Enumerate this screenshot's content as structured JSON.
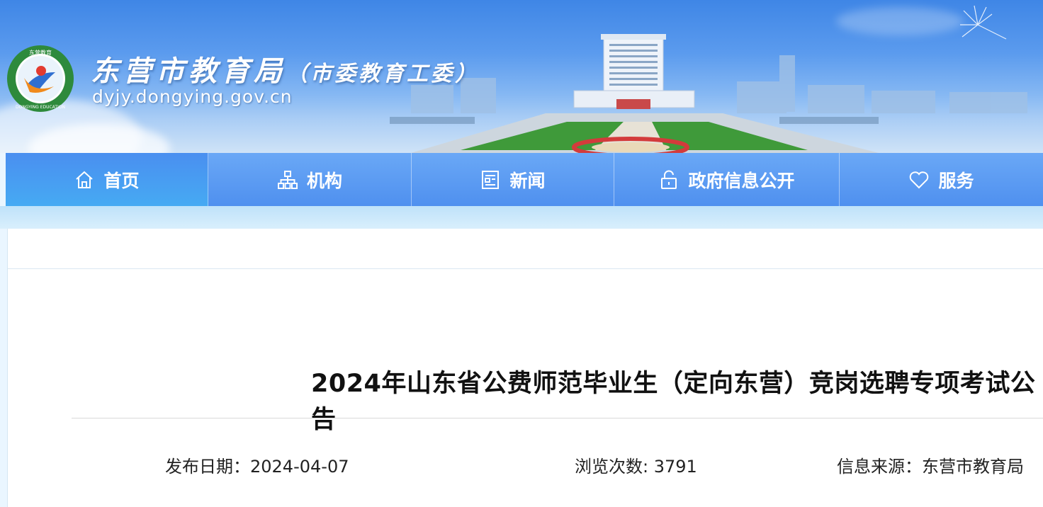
{
  "header": {
    "title_main": "东营市教育局",
    "title_sub": "（市委教育工委）",
    "domain": "dyjy.dongying.gov.cn",
    "logo_text_top": "东营教育",
    "logo_text_bottom": "DONGYING EDUCATION"
  },
  "nav": {
    "items": [
      {
        "label": "首页",
        "icon": "home-icon",
        "active": true
      },
      {
        "label": "机构",
        "icon": "org-chart-icon",
        "active": false
      },
      {
        "label": "新闻",
        "icon": "newspaper-icon",
        "active": false
      },
      {
        "label": "政府信息公开",
        "icon": "unlock-icon",
        "active": false
      },
      {
        "label": "服务",
        "icon": "heart-icon",
        "active": false
      }
    ]
  },
  "article": {
    "title": "2024年山东省公费师范毕业生（定向东营）竞岗选聘专项考试公告",
    "date_label": "发布日期：",
    "date": "2024-04-07",
    "views_label": "浏览次数: ",
    "views": "3791",
    "source_label": "信息来源：",
    "source": "东营市教育局"
  },
  "colors": {
    "nav_bg": "#5a9bf2",
    "nav_active": "#46aaf3",
    "banner_top": "#3f86e6"
  }
}
